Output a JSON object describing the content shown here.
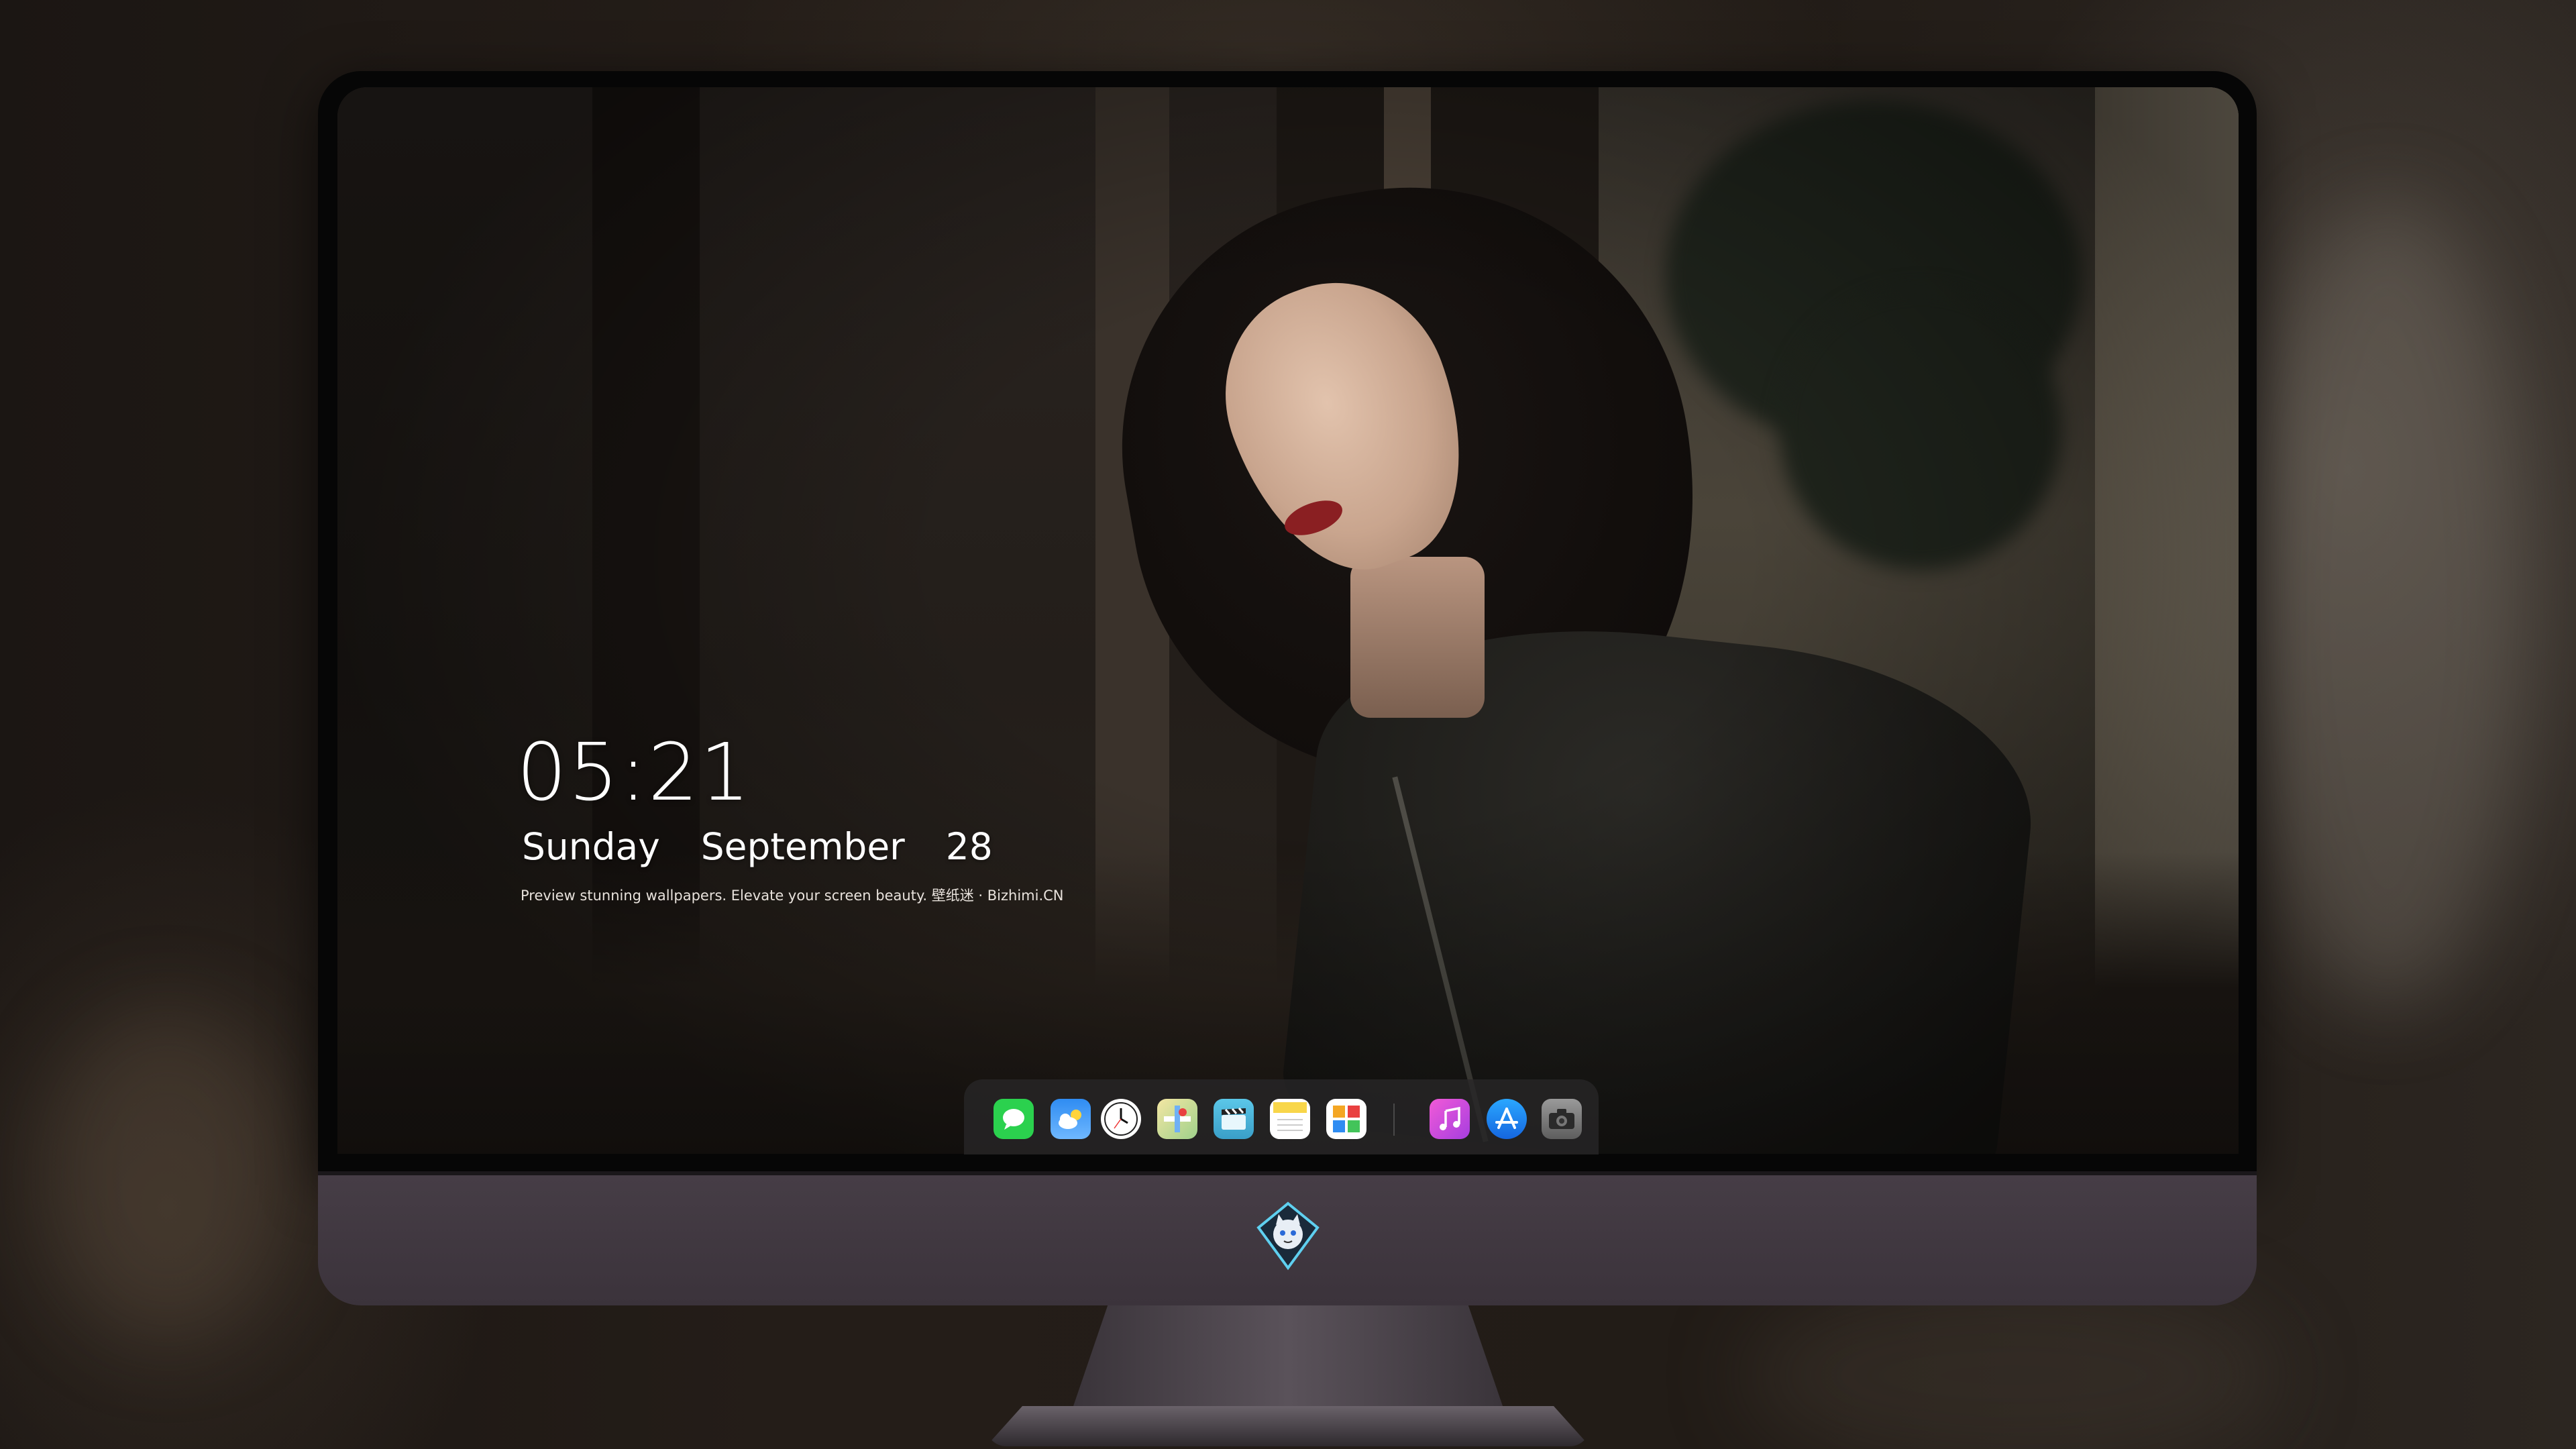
{
  "lock_screen": {
    "time": "05:21",
    "weekday": "Sunday",
    "month": "September",
    "day": "28",
    "tagline": "Preview stunning wallpapers. Elevate your screen beauty. 壁纸迷 · Bizhimi.CN"
  },
  "dock": {
    "items": [
      {
        "name": "messages",
        "icon": "chat-bubble-icon",
        "color": "#2bd14e"
      },
      {
        "name": "weather",
        "icon": "cloud-icon",
        "color": "#2f8cf2"
      },
      {
        "name": "clock",
        "icon": "clock-icon",
        "color": "#ffffff"
      },
      {
        "name": "maps",
        "icon": "map-icon",
        "color": "#e7d58a"
      },
      {
        "name": "videos",
        "icon": "clapper-icon",
        "color": "#5bc7e8"
      },
      {
        "name": "notes",
        "icon": "notes-icon",
        "color": "#f8d64a"
      },
      {
        "name": "photos",
        "icon": "photos-icon",
        "color": "#ffffff"
      },
      {
        "name": "music",
        "icon": "music-note-icon",
        "color": "#d64bd8"
      },
      {
        "name": "app-store",
        "icon": "app-store-icon",
        "color": "#1e8bf5"
      },
      {
        "name": "camera",
        "icon": "camera-icon",
        "color": "#8e8e8e"
      }
    ]
  },
  "colors": {
    "chin": "#3b333b",
    "bezel": "#060606",
    "dock_bg": "#282628"
  },
  "monitor_logo": "cat-mascot-logo-icon"
}
